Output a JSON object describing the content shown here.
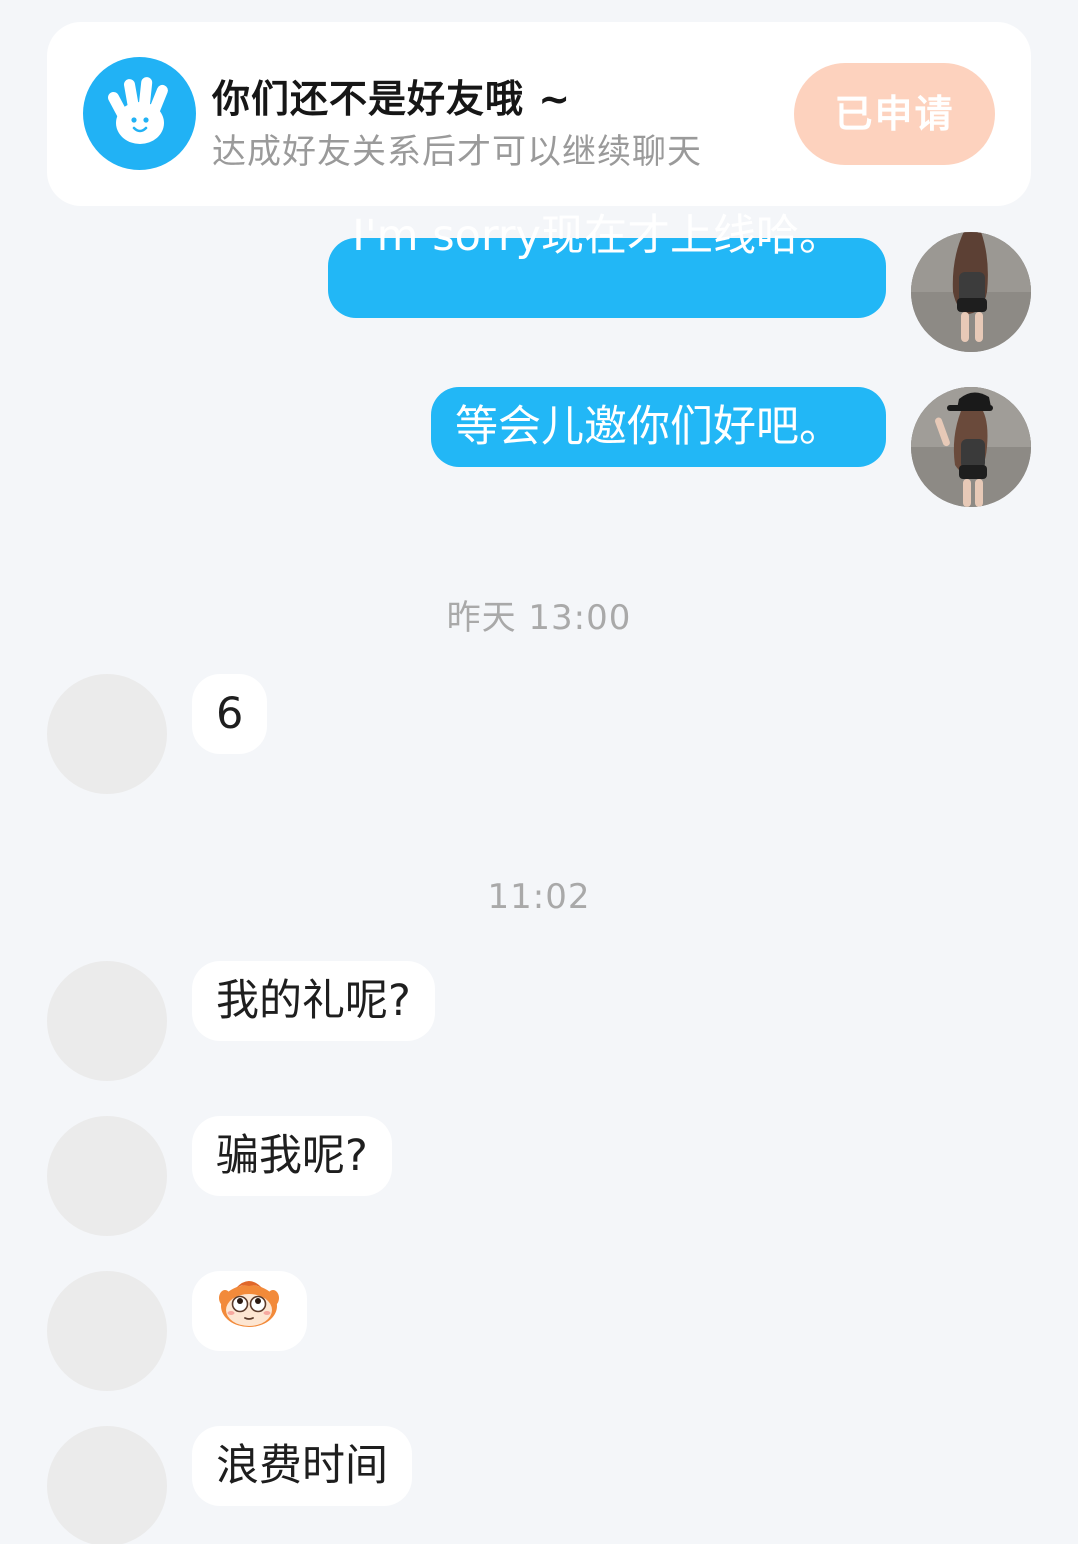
{
  "banner": {
    "icon": "waving-hand-icon",
    "title": "你们还不是好友哦 ~",
    "subtitle": "达成好友关系后才可以继续聊天",
    "apply_button": "已申请"
  },
  "messages": {
    "out_1": "I'm sorry现在才上线哈。",
    "out_2": "等会儿邀你们好吧。",
    "time_1": "昨天 13:00",
    "in_1": "6",
    "time_2": "11:02",
    "in_2": "我的礼呢?",
    "in_3": "骗我呢?",
    "in_4_emoji": "monkey-face-sticker",
    "in_5": "浪费时间"
  },
  "colors": {
    "background": "#f4f6f9",
    "outgoing_bubble": "#22b7f6",
    "incoming_bubble": "#ffffff",
    "apply_button": "#fdd2be",
    "banner_icon": "#21b2f5"
  }
}
